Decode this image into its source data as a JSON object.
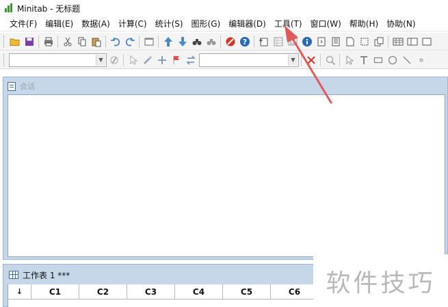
{
  "window": {
    "title": "Minitab - 无标题"
  },
  "menubar": {
    "items": [
      "文件(F)",
      "编辑(E)",
      "数据(A)",
      "计算(C)",
      "统计(S)",
      "图形(G)",
      "编辑器(D)",
      "工具(T)",
      "窗口(W)",
      "帮助(H)",
      "协助(N)"
    ]
  },
  "session": {
    "title": "会话"
  },
  "worksheet": {
    "title": "工作表 1 ***",
    "corner": "↓",
    "columns": [
      "C1",
      "C2",
      "C3",
      "C4",
      "C5",
      "C6"
    ]
  },
  "watermark": {
    "text": "软件技巧"
  },
  "colors": {
    "annotation_arrow": "#e05a5a",
    "window_frame": "#c6d7ea"
  }
}
